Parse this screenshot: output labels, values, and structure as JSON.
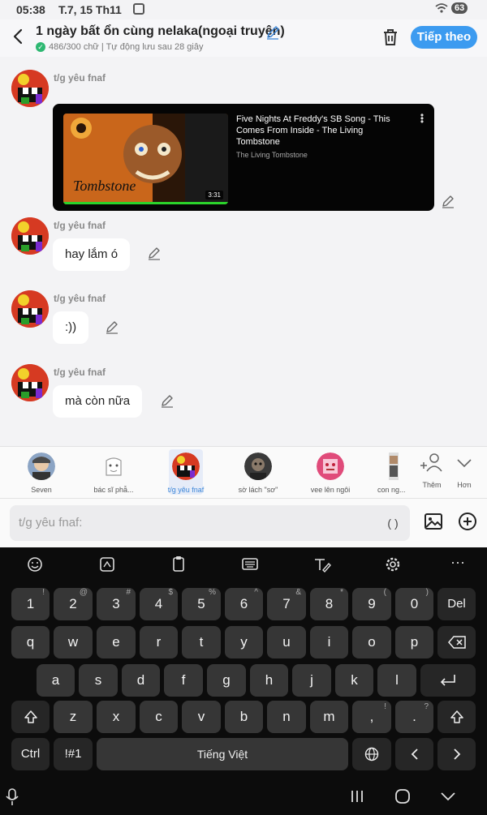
{
  "status": {
    "time": "05:38",
    "date": "T.7, 15 Th11",
    "battery": "63"
  },
  "header": {
    "title": "1 ngày bất ổn cùng nelaka(ngoại truyện)",
    "subtitle": "486/300 chữ | Tự động lưu sau 28 giây",
    "next_label": "Tiếp theo"
  },
  "messages": [
    {
      "sender": "t/g yêu fnaf",
      "video": {
        "title": "Five Nights At Freddy's SB Song - This Comes From Inside - The Living Tombstone",
        "channel": "The Living Tombstone",
        "duration": "3:31"
      }
    },
    {
      "sender": "t/g yêu fnaf",
      "text": "hay lắm ó"
    },
    {
      "sender": "t/g yêu fnaf",
      "text": ":))"
    },
    {
      "sender": "t/g yêu fnaf",
      "text": "mà còn nữa"
    }
  ],
  "characters": [
    {
      "label": "Seven"
    },
    {
      "label": "bác sĩ phẫ..."
    },
    {
      "label": "t/g yêu fnaf",
      "selected": true
    },
    {
      "label": "sờ lách \"sơ\""
    },
    {
      "label": "vee lên ngôi"
    },
    {
      "label": "con ng..."
    }
  ],
  "strip_buttons": {
    "add_label": "Thêm",
    "more_label": "Hơn"
  },
  "composer": {
    "placeholder": "t/g yêu fnaf:",
    "paren": "( )"
  },
  "keyboard": {
    "row1": [
      "1",
      "2",
      "3",
      "4",
      "5",
      "6",
      "7",
      "8",
      "9",
      "0"
    ],
    "row1_sup": [
      "!",
      "@",
      "#",
      "$",
      "%",
      "^",
      "&",
      "*",
      "(",
      ")"
    ],
    "del": "Del",
    "row2": [
      "q",
      "w",
      "e",
      "r",
      "t",
      "y",
      "u",
      "i",
      "o",
      "p"
    ],
    "row3": [
      "a",
      "s",
      "d",
      "f",
      "g",
      "h",
      "j",
      "k",
      "l"
    ],
    "row4": [
      "z",
      "x",
      "c",
      "v",
      "b",
      "n",
      "m",
      ",",
      "."
    ],
    "row4_sup": [
      "!",
      "?"
    ],
    "ctrl": "Ctrl",
    "sym": "!#1",
    "space": "Tiếng Việt"
  }
}
